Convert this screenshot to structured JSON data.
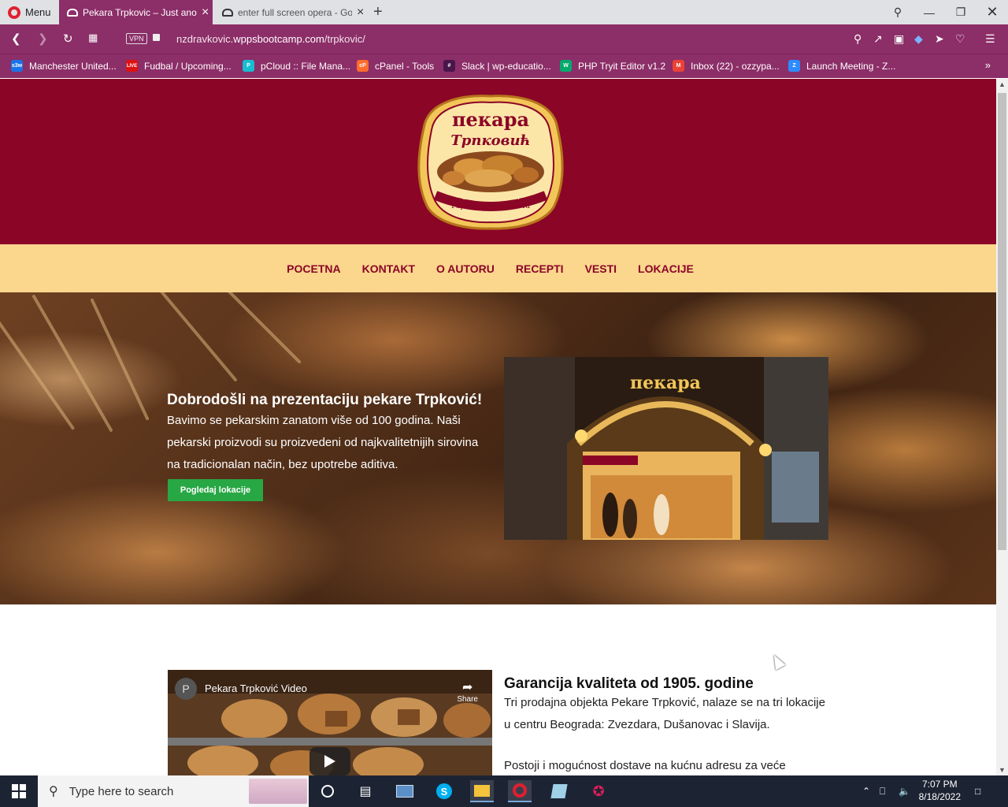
{
  "browser": {
    "menu_label": "Menu",
    "tabs": [
      {
        "title": "Pekara Trpkovic – Just anoth",
        "active": true
      },
      {
        "title": "enter full screen opera - Go",
        "active": false
      }
    ],
    "url_prefix": "nzdravkovic.",
    "url_host": "wppsbootcamp.com",
    "url_path": "/trpkovic/",
    "vpn_label": "VPN",
    "bookmarks": [
      {
        "label": "Manchester United...",
        "fav_text": "s3w",
        "color": "#1a73e8"
      },
      {
        "label": "Fudbal / Upcoming...",
        "fav_text": "LIVE",
        "color": "#d11"
      },
      {
        "label": "pCloud :: File Mana...",
        "fav_text": "P",
        "color": "#17bed0"
      },
      {
        "label": "cPanel - Tools",
        "fav_text": "cP",
        "color": "#ff6c2c"
      },
      {
        "label": "Slack | wp-educatio...",
        "fav_text": "#",
        "color": "#4a154b"
      },
      {
        "label": "PHP Tryit Editor v1.2",
        "fav_text": "W",
        "color": "#04aa6d"
      },
      {
        "label": "Inbox (22) - ozzypa...",
        "fav_text": "M",
        "color": "#ea4335"
      },
      {
        "label": "Launch Meeting - Z...",
        "fav_text": "Z",
        "color": "#2d8cff"
      }
    ]
  },
  "site": {
    "nav": [
      "POCETNA",
      "KONTAKT",
      "O AUTORU",
      "RECEPTI",
      "VESTI",
      "LOKACIJE"
    ],
    "logo": {
      "top": "пекара",
      "name": "Трпковић",
      "line1": "Основана 1905.",
      "line2": "Гаранција квалитета"
    },
    "hero": {
      "title": "Dobrodošli na prezentaciju pekare Trpković!",
      "text": "Bavimo se pekarskim zanatom više od 100 godina. Naši pekarski proizvodi su proizvedeni od najkvalitetnijih sirovina na tradicionalan način, bez upotrebe aditiva.",
      "button": "Pogledaj lokacije",
      "shop_sign": "пекара"
    },
    "video": {
      "avatar": "P",
      "title": "Pekara Trpković Video",
      "share": "Share"
    },
    "section": {
      "title": "Garancija kvaliteta od 1905. godine",
      "text": "Tri prodajna objekta Pekare Trpković, nalaze se na tri lokacije u centru Beograda: Zvezdara, Dušanovac i Slavija.",
      "text2": "Postoji i mogućnost dostave na kućnu adresu za veće"
    },
    "colors": {
      "header": "#8b0527",
      "nav_bg": "#fbd68d",
      "button": "#28a745"
    }
  },
  "taskbar": {
    "search_placeholder": "Type here to search",
    "time": "7:07 PM",
    "date": "8/18/2022"
  }
}
